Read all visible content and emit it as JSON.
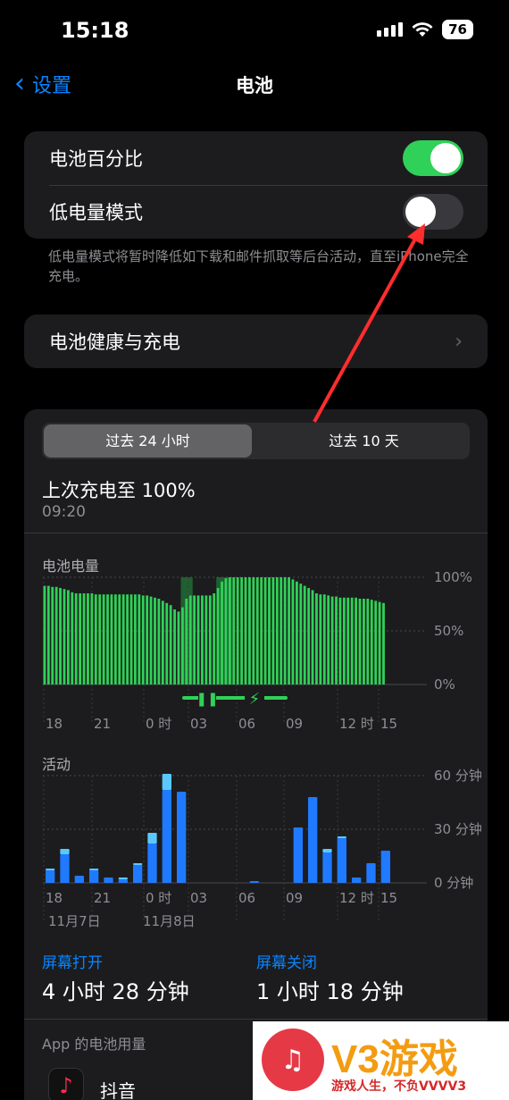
{
  "status": {
    "time": "15:18",
    "battery": "76"
  },
  "nav": {
    "back": "设置",
    "title": "电池"
  },
  "settings": {
    "battery_percentage": {
      "label": "电池百分比",
      "on": true
    },
    "low_power_mode": {
      "label": "低电量模式",
      "on": false
    },
    "footnote": "低电量模式将暂时降低如下载和邮件抓取等后台活动，直至iPhone完全充电。"
  },
  "health": {
    "label": "电池健康与充电"
  },
  "segmented": {
    "options": [
      "过去 24 小时",
      "过去 10 天"
    ],
    "selected": 0
  },
  "last_charge": {
    "title": "上次充电至 100%",
    "time": "09:20"
  },
  "battery_chart": {
    "label": "电池电量",
    "y_ticks": [
      "100%",
      "50%",
      "0%"
    ],
    "x_ticks": [
      "18",
      "21",
      "0 时",
      "03",
      "06",
      "09",
      "12 时",
      "15"
    ]
  },
  "activity_chart": {
    "label": "活动",
    "y_ticks": [
      "60 分钟",
      "30 分钟",
      "0 分钟"
    ],
    "x_ticks": [
      "18",
      "21",
      "0 时",
      "03",
      "06",
      "09",
      "12 时",
      "15"
    ],
    "date_labels": [
      "11月7日",
      "11月8日"
    ]
  },
  "chart_data": [
    {
      "type": "bar",
      "title": "电池电量",
      "ylim": [
        0,
        100
      ],
      "x_ticks": [
        "18",
        "21",
        "0 时",
        "03",
        "06",
        "09",
        "12 时",
        "15"
      ],
      "values": [
        92,
        92,
        91,
        91,
        90,
        89,
        88,
        86,
        85,
        85,
        85,
        85,
        85,
        84,
        84,
        84,
        84,
        84,
        84,
        84,
        84,
        84,
        84,
        84,
        84,
        83,
        83,
        82,
        81,
        80,
        78,
        76,
        74,
        70,
        68,
        72,
        80,
        83,
        83,
        83,
        83,
        83,
        83,
        85,
        90,
        96,
        99,
        100,
        100,
        100,
        100,
        100,
        100,
        100,
        100,
        100,
        100,
        100,
        100,
        100,
        100,
        100,
        100,
        98,
        96,
        94,
        92,
        90,
        88,
        85,
        84,
        84,
        83,
        82,
        82,
        81,
        81,
        81,
        81,
        81,
        80,
        80,
        80,
        79,
        78,
        77,
        76
      ],
      "charging_ranges": [
        [
          35,
          37
        ],
        [
          44,
          47
        ]
      ],
      "colors": {
        "bar": "#30d158",
        "charging_band": "#1f5f30"
      }
    },
    {
      "type": "bar",
      "title": "活动",
      "ylim": [
        0,
        60
      ],
      "x_ticks": [
        "18",
        "21",
        "0 时",
        "03",
        "06",
        "09",
        "12 时",
        "15"
      ],
      "series": [
        {
          "name": "屏幕打开",
          "values": [
            7,
            16,
            4,
            7,
            3,
            2,
            10,
            22,
            52,
            51,
            0,
            0,
            0,
            0,
            1,
            0,
            0,
            31,
            48,
            17,
            25,
            3,
            11,
            18
          ]
        },
        {
          "name": "屏幕关闭",
          "values": [
            1,
            3,
            0,
            1,
            0,
            1,
            1,
            6,
            9,
            0,
            0,
            0,
            0,
            0,
            0,
            0,
            0,
            0,
            0,
            2,
            1,
            0,
            0,
            0
          ]
        }
      ],
      "colors": {
        "screen_on": "#1f7aff",
        "screen_off": "#5ac8fa"
      }
    }
  ],
  "usage": {
    "screen_on": {
      "label": "屏幕打开",
      "value": "4 小时 28 分钟"
    },
    "screen_off": {
      "label": "屏幕关闭",
      "value": "1 小时 18 分钟"
    }
  },
  "app_usage": {
    "heading": "App 的电池用量",
    "apps": [
      {
        "name": "抖音",
        "icon": "tiktok-icon"
      }
    ]
  },
  "watermark": {
    "brand": "V3游戏",
    "slogan": "游戏人生，不负VVVV3"
  },
  "colors": {
    "accent": "#0a84ff",
    "green": "#30d158",
    "background": "#000000",
    "card": "#1c1c1e",
    "annotation": "#ff2d2d"
  }
}
